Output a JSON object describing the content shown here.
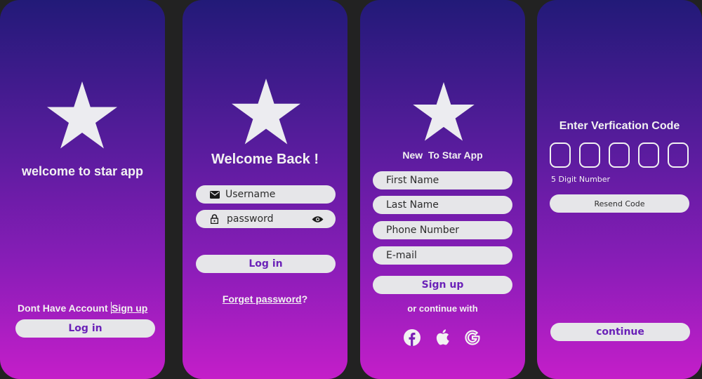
{
  "screen1": {
    "title": "welcome to star app",
    "no_account_text": "Dont Have Account ",
    "sign_up_link": "Sign up",
    "login_button": "Log in"
  },
  "screen2": {
    "title": "Welcome Back !",
    "username_placeholder": "Username",
    "password_placeholder": "password",
    "login_button": "Log in",
    "forgot_link": "Forget password",
    "forgot_suffix": "?"
  },
  "screen3": {
    "title": "New  To Star App",
    "first_name": "First Name",
    "last_name": "Last Name",
    "phone_number": "Phone Number",
    "email": "E-mail",
    "signup_button": "Sign up",
    "continue_with": "or continue with",
    "social": [
      "facebook-icon",
      "apple-icon",
      "google-icon"
    ]
  },
  "screen4": {
    "title": "Enter Verfication Code",
    "hint": "5 Digit Number",
    "resend_button": "Resend Code",
    "continue_button": "continue",
    "digit_count": 5
  },
  "colors": {
    "gradient_top": "#221a78",
    "gradient_bottom": "#c41ec9",
    "pill_bg": "#e6e6e9",
    "button_text": "#6b22b8",
    "background": "#222222"
  }
}
